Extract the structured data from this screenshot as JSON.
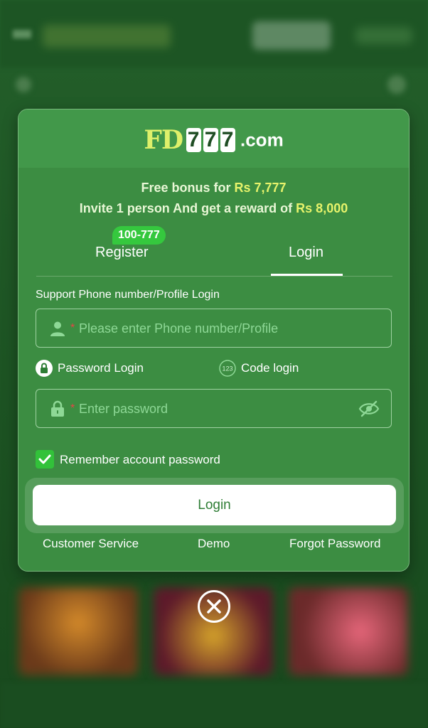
{
  "brand": {
    "prefix": "FD",
    "digits": [
      "7",
      "7",
      "7"
    ],
    "suffix": ".com"
  },
  "promo": {
    "line1_text": "Free bonus for ",
    "line1_amount": "Rs 7,777",
    "line2_text": "Invite 1 person And get a reward of ",
    "line2_amount": "Rs 8,000"
  },
  "tabs": {
    "register_label": "Register",
    "register_tag": "100-777",
    "login_label": "Login",
    "active": "login"
  },
  "form": {
    "support_label": "Support Phone number/Profile Login",
    "phone_required_mark": "*",
    "phone_placeholder": "Please enter Phone number/Profile",
    "phone_value": "",
    "password_method_label": "Password Login",
    "code_method_label": "Code login",
    "code_icon_text": "123",
    "password_required_mark": "*",
    "password_placeholder": "Enter password",
    "password_value": "",
    "remember_label": "Remember account password",
    "remember_checked": true,
    "login_button_label": "Login"
  },
  "footer_links": {
    "customer_service": "Customer Service",
    "demo": "Demo",
    "forgot_password": "Forgot Password"
  },
  "colors": {
    "modal_bg": "#3c8d42",
    "highlight": "#e7f36b",
    "tag_green": "#35c83e",
    "button_text": "#2e7d35"
  }
}
